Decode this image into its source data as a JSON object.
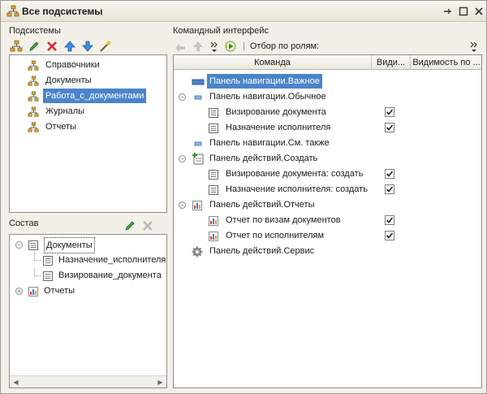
{
  "window": {
    "title": "Все подсистемы"
  },
  "subsystems": {
    "label": "Подсистемы",
    "items": [
      {
        "label": "Справочники"
      },
      {
        "label": "Документы"
      },
      {
        "label": "Работа_с_документами",
        "selected": true
      },
      {
        "label": "Журналы"
      },
      {
        "label": "Отчеты"
      }
    ]
  },
  "composition": {
    "label": "Состав",
    "items": [
      {
        "label": "Документы",
        "level": 0,
        "expanded": true
      },
      {
        "label": "Назначение_исполнителя",
        "level": 1
      },
      {
        "label": "Визирование_документа",
        "level": 1
      },
      {
        "label": "Отчеты",
        "level": 0,
        "expanded": false
      }
    ]
  },
  "command_interface": {
    "label": "Командный интерфейс",
    "filter_label": "Отбор по ролям:",
    "columns": {
      "command": "Команда",
      "visible": "Види...",
      "visibility_by": "Видимость по ..."
    },
    "rows": [
      {
        "label": "Панель навигации.Важное",
        "level": 0,
        "selected": true,
        "icon": "nav-important-icon"
      },
      {
        "label": "Панель навигации.Обычное",
        "level": 0,
        "expander": "minus",
        "icon": "nav-normal-icon"
      },
      {
        "label": "Визирование документа",
        "level": 1,
        "checked": true,
        "icon": "document-icon"
      },
      {
        "label": "Назначение исполнителя",
        "level": 1,
        "checked": true,
        "icon": "document-icon"
      },
      {
        "label": "Панель навигации.См. также",
        "level": 0,
        "icon": "nav-normal-icon"
      },
      {
        "label": "Панель действий.Создать",
        "level": 0,
        "expander": "minus",
        "icon": "create-icon"
      },
      {
        "label": "Визирование документа: создать",
        "level": 1,
        "checked": true,
        "icon": "document-icon"
      },
      {
        "label": "Назначение исполнителя: создать",
        "level": 1,
        "checked": true,
        "icon": "document-icon"
      },
      {
        "label": "Панель действий.Отчеты",
        "level": 0,
        "expander": "minus",
        "icon": "report-icon"
      },
      {
        "label": "Отчет по визам документов",
        "level": 1,
        "checked": true,
        "icon": "report-icon"
      },
      {
        "label": "Отчет по исполнителям",
        "level": 1,
        "checked": true,
        "icon": "report-icon"
      },
      {
        "label": "Панель действий.Сервис",
        "level": 0,
        "icon": "gear-icon"
      }
    ]
  }
}
